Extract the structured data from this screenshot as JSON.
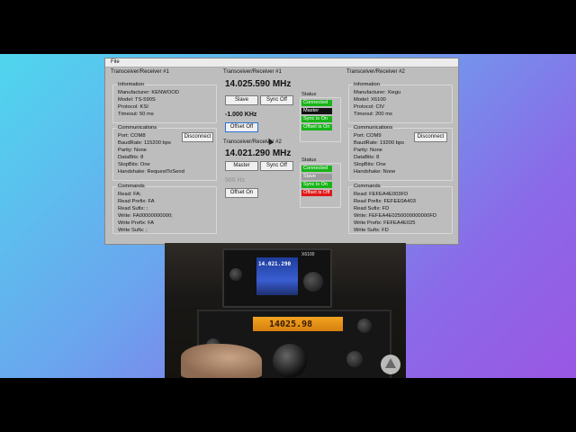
{
  "menu": {
    "file": "File"
  },
  "left": {
    "title": "Transceiver/Receiver #1",
    "info": {
      "title": "Information",
      "rows": [
        "Manufacturer:  KENWOOD",
        "Model:   TS-590S",
        "Protocol:   KSI",
        "Timeout:   50 ms"
      ]
    },
    "comms": {
      "title": "Communications",
      "rows": [
        "Port:   COM8",
        "BaudRate:   115200 bps",
        "Parity:   None",
        "DataBits:   8",
        "StopBits:   One",
        "Handshake:   RequestToSend"
      ],
      "button": "Disconnect"
    },
    "commands": {
      "title": "Commands",
      "rows": [
        "Read:   FA;",
        "Read Prefix:   FA",
        "Read Sufix:   ;",
        "Write:   FA00000000000;",
        "Write Prefix:   FA",
        "Write Sufix:   ;"
      ]
    }
  },
  "middle": {
    "r1": {
      "title": "Transceiver/Receiver #1",
      "freq": "14.025.590 MHz",
      "btn1": "Slave",
      "btn2": "Sync Off",
      "offset": "-1.000 KHz",
      "offset_btn": "Offset Off",
      "status_title": "Status",
      "status": [
        "Connected",
        "Master",
        "Sync is On",
        "Offset is On"
      ]
    },
    "r2": {
      "title": "Transceiver/Receiver #2",
      "freq": "14.021.290 MHz",
      "btn1": "Master",
      "btn2": "Sync Off",
      "offset": "500 Hz",
      "offset_btn": "Offset On",
      "status_title": "Status",
      "status": [
        "Connected",
        "Slave",
        "Sync is On",
        "Offset is Off"
      ]
    }
  },
  "right": {
    "title": "Transceiver/Receiver #2",
    "info": {
      "title": "Information",
      "rows": [
        "Manufacturer:   Xiegu",
        "Model:   X6100",
        "Protocol:   CIV",
        "Timeout:   200 ms"
      ]
    },
    "comms": {
      "title": "Communications",
      "rows": [
        "Port:   COM9",
        "BaudRate:   19200 bps",
        "Parity:   None",
        "DataBits:   8",
        "StopBits:   One",
        "Handshake:   None"
      ],
      "button": "Disconnect"
    },
    "commands": {
      "title": "Commands",
      "rows": [
        "Read:   FEFEA4E003FD",
        "Read Prefix:   FEFEE0A403",
        "Read Sufix:   FD",
        "Write:   FEFEA4E0250000000000FD",
        "Write Prefix:   FEFEA4E025",
        "Write Sufix:   FD"
      ]
    }
  },
  "photo": {
    "rig_top_label": "X6100",
    "rig_top_freq": "14.021.290",
    "rig_main_freq": "14025.98"
  },
  "colors": {
    "connected": "#18b418",
    "master": "#111111",
    "sync_on": "#18b418",
    "offset_off": "#e01818",
    "slave": "#9c9c9c"
  }
}
